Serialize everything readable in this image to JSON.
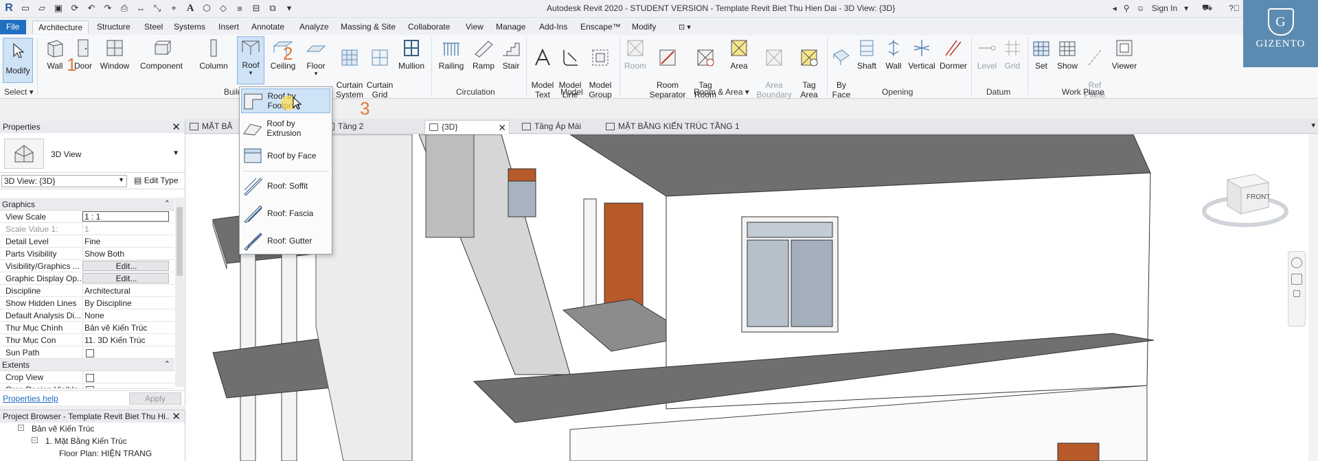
{
  "window": {
    "title": "Autodesk Revit 2020 - STUDENT VERSION - Template Revit Biet Thu Hien Dai - 3D View: {3D}",
    "sign_in": "Sign In"
  },
  "ribbon_tabs": [
    "File",
    "Architecture",
    "Structure",
    "Steel",
    "Systems",
    "Insert",
    "Annotate",
    "Analyze",
    "Massing & Site",
    "Collaborate",
    "View",
    "Manage",
    "Add-Ins",
    "Enscape™",
    "Modify"
  ],
  "active_tab": "Architecture",
  "ribbon": {
    "select": {
      "modify": "Modify",
      "panel": "Select ▾"
    },
    "build": {
      "wall": "Wall",
      "door": "Door",
      "window": "Window",
      "component": "Component",
      "column": "Column",
      "roof": "Roof",
      "ceiling": "Ceiling",
      "floor": "Floor",
      "curtain_system": "Curtain\nSystem",
      "curtain_grid": "Curtain\nGrid",
      "mullion": "Mullion",
      "panel": "Build"
    },
    "circulation": {
      "railing": "Railing",
      "ramp": "Ramp",
      "stair": "Stair",
      "panel": "Circulation"
    },
    "model": {
      "model_text": "Model\nText",
      "model_line": "Model\nLine",
      "model_group": "Model\nGroup",
      "panel": "Model"
    },
    "room_area": {
      "room": "Room",
      "room_separator": "Room\nSeparator",
      "tag_room": "Tag\nRoom",
      "area": "Area",
      "area_boundary": "Area\nBoundary",
      "tag_area": "Tag\nArea",
      "panel": "Room & Area ▾"
    },
    "opening": {
      "by_face": "By\nFace",
      "shaft": "Shaft",
      "wall": "Wall",
      "vertical": "Vertical",
      "dormer": "Dormer",
      "panel": "Opening"
    },
    "datum": {
      "level": "Level",
      "grid": "Grid",
      "panel": "Datum"
    },
    "work_plane": {
      "set": "Set",
      "show": "Show",
      "ref_plane": "Ref\nPlane",
      "viewer": "Viewer",
      "panel": "Work Plane"
    }
  },
  "roof_dropdown": {
    "items": [
      "Roof by Footprint",
      "Roof by Extrusion",
      "Roof by Face",
      "Roof: Soffit",
      "Roof: Fascia",
      "Roof: Gutter"
    ]
  },
  "step_markers": [
    "1",
    "2",
    "3"
  ],
  "brand": {
    "name": "GIZENTO",
    "initial": "G"
  },
  "view_tabs": [
    {
      "label": "MẶT BẰ",
      "active": false
    },
    {
      "label": "Tầng 2",
      "active": false
    },
    {
      "label": "{3D}",
      "active": true
    },
    {
      "label": "Tầng Áp Mái",
      "active": false
    },
    {
      "label": "MẶT BẰNG KIẾN TRÚC TẦNG 1",
      "active": false
    }
  ],
  "properties": {
    "header": "Properties",
    "type_label": "3D View",
    "view_selector": "3D View: {3D}",
    "edit_type": "Edit Type",
    "sections": {
      "graphics": "Graphics",
      "extents": "Extents"
    },
    "graphics_rows": [
      {
        "key": "View Scale",
        "value": "1 : 1"
      },
      {
        "key": "Scale Value    1:",
        "value": "1"
      },
      {
        "key": "Detail Level",
        "value": "Fine"
      },
      {
        "key": "Parts Visibility",
        "value": "Show Both"
      },
      {
        "key": "Visibility/Graphics ...",
        "value": "Edit..."
      },
      {
        "key": "Graphic Display Op...",
        "value": "Edit..."
      },
      {
        "key": "Discipline",
        "value": "Architectural"
      },
      {
        "key": "Show Hidden Lines",
        "value": "By Discipline"
      },
      {
        "key": "Default Analysis Di...",
        "value": "None"
      },
      {
        "key": "Thư Mục Chính",
        "value": "Bản vẽ Kiến Trúc"
      },
      {
        "key": "Thư Mục Con",
        "value": "11. 3D Kiến Trúc"
      },
      {
        "key": "Sun Path",
        "value": ""
      }
    ],
    "extents_rows": [
      {
        "key": "Crop View",
        "value": ""
      },
      {
        "key": "Crop Region Visible",
        "value": ""
      }
    ],
    "help": "Properties help",
    "apply": "Apply"
  },
  "project_browser": {
    "header": "Project Browser - Template Revit Biet Thu Hi...",
    "items": [
      "Bản vẽ Kiến Trúc",
      "1. Mặt Bằng Kiến Trúc",
      "Floor Plan: HIỆN TRANG"
    ]
  },
  "viewcube": {
    "face": "FRONT"
  }
}
